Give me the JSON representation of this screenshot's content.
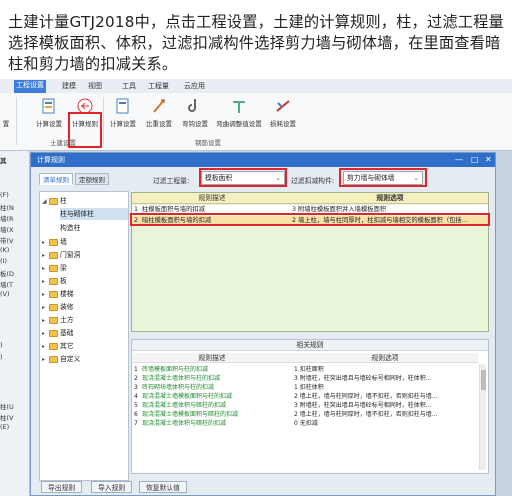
{
  "question": "土建计量GTJ2018中，点击工程设置，土建的计算规则，柱，过滤工程量选择模板面积、体积，过滤扣减构件选择剪力墙与砌体墙，在里面查看暗柱和剪力墙的扣减关系。",
  "ribbon_tabs": [
    "工程设置",
    "建模",
    "视图",
    "工具",
    "工程量",
    "云应用"
  ],
  "ribbon_buttons": [
    "计算设置",
    "计算规则",
    "计算设置",
    "比重设置",
    "弯钩设置",
    "弯曲调整值设置",
    "损耗设置"
  ],
  "ribbon_left_fragment": "置",
  "group_labels": {
    "tujian": "土建设置",
    "gangjin": "钢筋设置"
  },
  "left_strip": [
    "其",
    "(F)",
    "柱(N",
    "墙(R",
    "墙(X",
    "带(V",
    "(K)",
    "(I)",
    "板(D",
    "墙(T",
    "(V)",
    "",
    "",
    ")",
    ")",
    "",
    "",
    "柱(U",
    "柱(V",
    "(E)"
  ],
  "dialog": {
    "title": "计算规则",
    "window_buttons": [
      "—",
      "□",
      "✕"
    ],
    "tabs": [
      "清单规则",
      "定额规则"
    ],
    "filter_qty_label": "过滤工程量:",
    "filter_qty_value": "模板面积",
    "filter_deduct_label": "过滤扣减构件:",
    "filter_deduct_value": "剪力墙与砌体墙"
  },
  "tree": [
    {
      "label": "柱",
      "level": 0,
      "expanded": true
    },
    {
      "label": "柱与砌体柱",
      "level": 1,
      "selected": true
    },
    {
      "label": "构造柱",
      "level": 1
    },
    {
      "label": "墙",
      "level": 0
    },
    {
      "label": "门窗洞",
      "level": 0
    },
    {
      "label": "梁",
      "level": 0
    },
    {
      "label": "板",
      "level": 0
    },
    {
      "label": "楼梯",
      "level": 0
    },
    {
      "label": "装修",
      "level": 0
    },
    {
      "label": "土方",
      "level": 0
    },
    {
      "label": "基础",
      "level": 0
    },
    {
      "label": "其它",
      "level": 0
    },
    {
      "label": "自定义",
      "level": 0
    }
  ],
  "main_grid": {
    "headers": [
      "规则描述",
      "规则选项"
    ],
    "rows": [
      {
        "no": "1",
        "desc": "柱模板面积与墙的扣减",
        "option": "3 附墙柱模板面积并入墙模板面积"
      },
      {
        "no": "2",
        "desc": "暗柱模板面积与墙的扣减",
        "option": "2 墙上柱，墙与柱同厚时，柱扣减与墙相交的模板面积（包括…",
        "selected": true
      }
    ]
  },
  "related": {
    "title": "相关规则",
    "headers": [
      "规则描述",
      "规则选项"
    ],
    "rows": [
      {
        "no": "1",
        "desc": "砖墙模板面积与柱的扣减",
        "option": "1 扣柱面积"
      },
      {
        "no": "2",
        "desc": "现浇混凝土墙体积与柱的扣减",
        "option": "3 附墙柱，柱突出墙且与墙砼标号相同时，柱体积…"
      },
      {
        "no": "3",
        "desc": "砖石砌块墙体积与柱的扣减",
        "option": "1 扣柱体积"
      },
      {
        "no": "4",
        "desc": "现浇混凝土墙模板面积与柱的扣减",
        "option": "2 墙上柱，墙与柱同厚时，墙不扣柱，否则扣柱与墙…"
      },
      {
        "no": "5",
        "desc": "现浇混凝土墙体积与暗柱的扣减",
        "option": "3 附墙柱，柱突出墙且与墙砼标号相同时，柱体积…"
      },
      {
        "no": "6",
        "desc": "现浇混凝土墙模板面积与暗柱的扣减",
        "option": "2 墙上柱，墙与柱同厚时，墙不扣柱，否则扣柱与墙…"
      },
      {
        "no": "7",
        "desc": "现浇混凝土墙体积与暗柱的扣减",
        "option": "0 无扣减"
      }
    ]
  },
  "bottom_buttons": [
    "导出规则",
    "导入规则",
    "恢复默认值"
  ]
}
